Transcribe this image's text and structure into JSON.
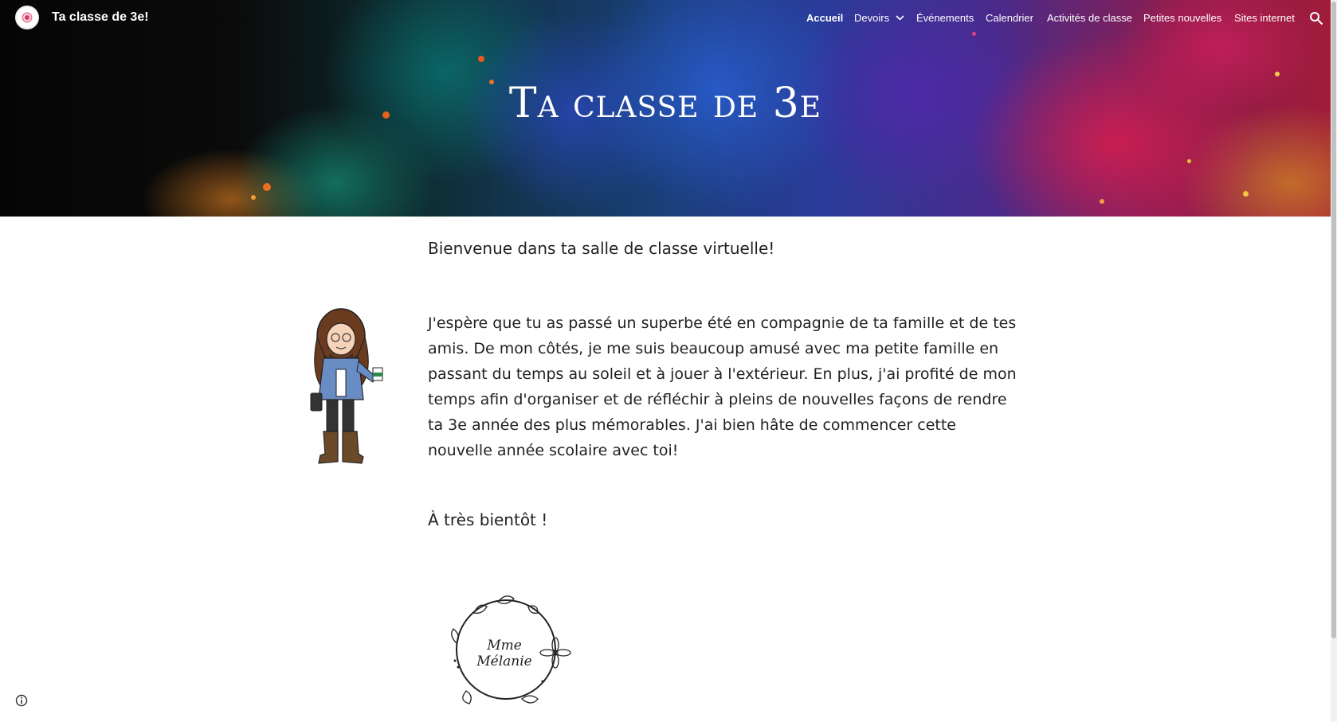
{
  "header": {
    "site_title": "Ta classe de 3e!",
    "hero_title": "Ta classe de 3e",
    "nav": [
      {
        "label": "Accueil",
        "active": true
      },
      {
        "label": "Devoirs",
        "has_dropdown": true
      },
      {
        "label": "Événements"
      },
      {
        "label": "Calendrier"
      },
      {
        "label": "Activités de classe"
      },
      {
        "label": "Petites nouvelles"
      },
      {
        "label": "Sites internet"
      }
    ],
    "icons": {
      "logo": "logo-icon",
      "search": "search-icon",
      "dropdown": "chevron-down-icon"
    }
  },
  "main": {
    "welcome": "Bienvenue dans ta salle de classe virtuelle!",
    "paragraph": "J'espère que tu as passé un superbe été en compagnie de ta famille et de tes amis. De mon côtés, je me suis beaucoup amusé avec ma petite famille en passant du temps au soleil et à jouer à l'extérieur. En plus, j'ai profité de mon temps afin d'organiser et de réfléchir à pleins de nouvelles façons de rendre ta 3e année des plus mémorables. J'ai bien hâte de commencer cette nouvelle année scolaire avec toi!",
    "closing": "À très bientôt !",
    "signature": "Mme Mélanie"
  },
  "footer": {
    "info_icon": "info-icon"
  },
  "colors": {
    "nav_text": "#ffffff",
    "body_text": "#222222",
    "background": "#ffffff"
  }
}
